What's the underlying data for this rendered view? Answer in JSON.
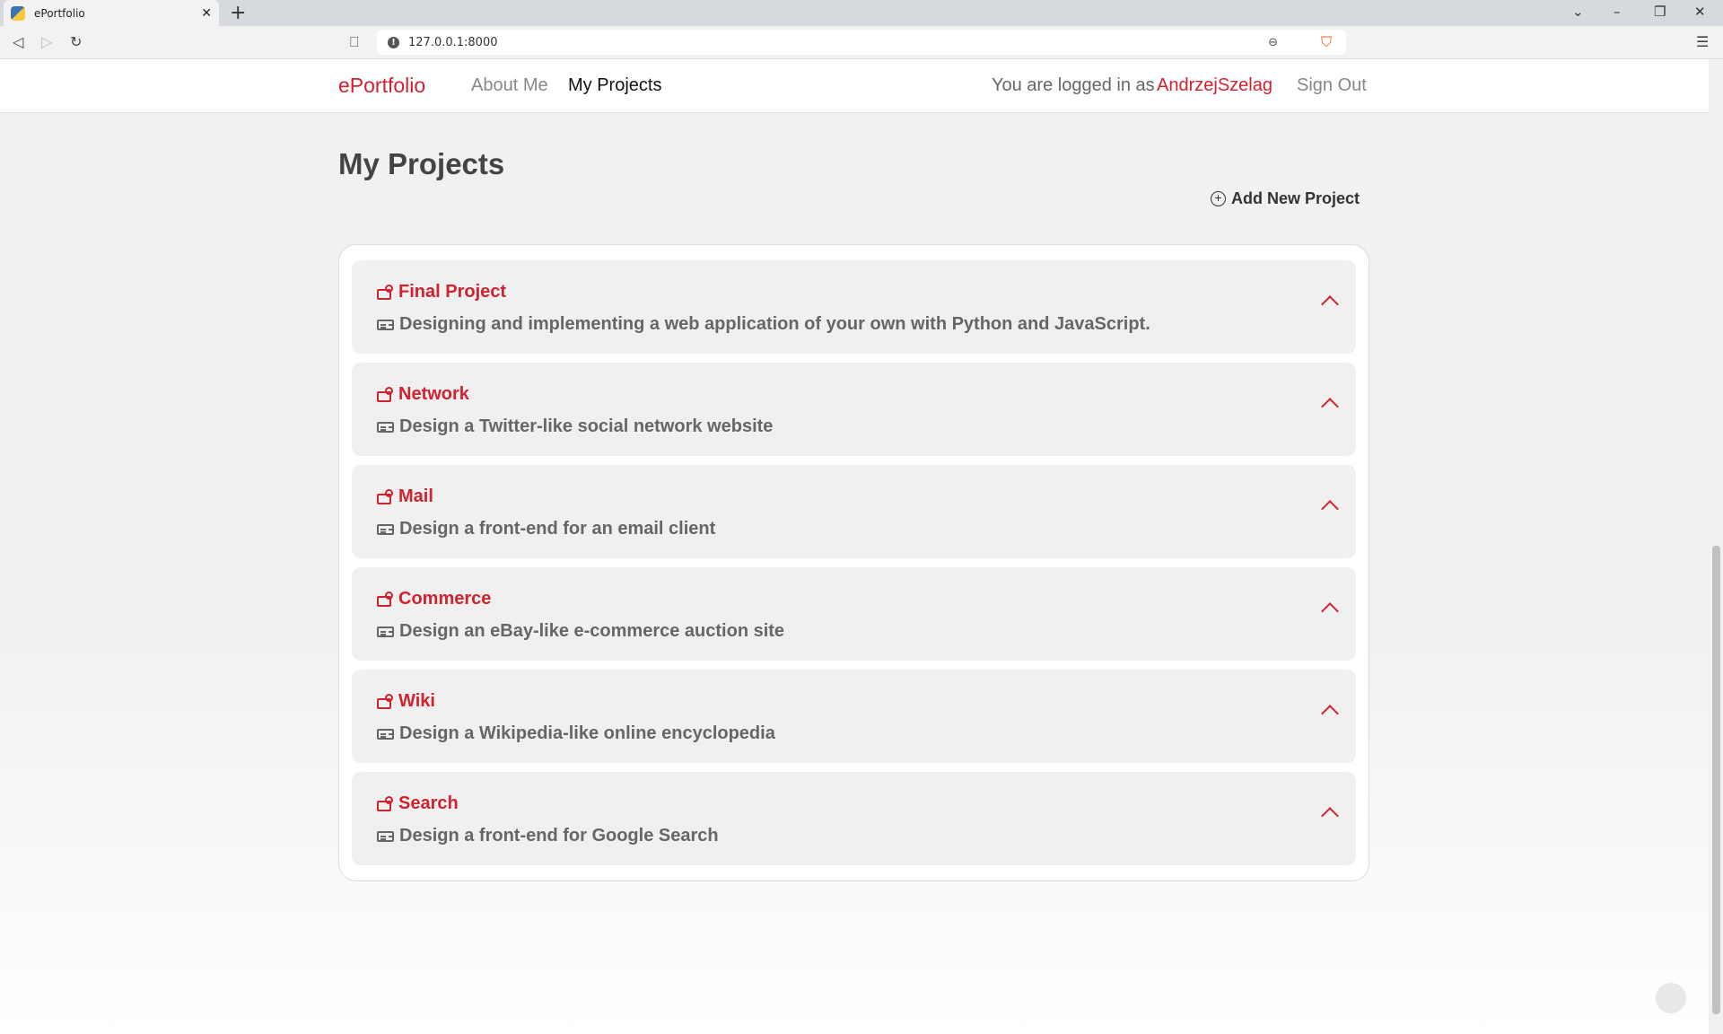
{
  "browser": {
    "tab_title": "ePortfolio",
    "url": "127.0.0.1:8000"
  },
  "nav": {
    "brand": "ePortfolio",
    "about": "About Me",
    "projects": "My Projects",
    "logged_in_prefix": "You are logged in as",
    "username": "AndrzejSzelag",
    "sign_out": "Sign Out"
  },
  "page": {
    "title": "My Projects",
    "add_button": "Add New Project"
  },
  "projects": [
    {
      "title": "Final Project",
      "description": "Designing and implementing a web application of your own with Python and JavaScript."
    },
    {
      "title": "Network",
      "description": "Design a Twitter-like social network website"
    },
    {
      "title": "Mail",
      "description": "Design a front-end for an email client"
    },
    {
      "title": "Commerce",
      "description": "Design an eBay-like e-commerce auction site"
    },
    {
      "title": "Wiki",
      "description": "Design a Wikipedia-like online encyclopedia"
    },
    {
      "title": "Search",
      "description": "Design a front-end for Google Search"
    }
  ],
  "colors": {
    "accent": "#d0222f"
  }
}
